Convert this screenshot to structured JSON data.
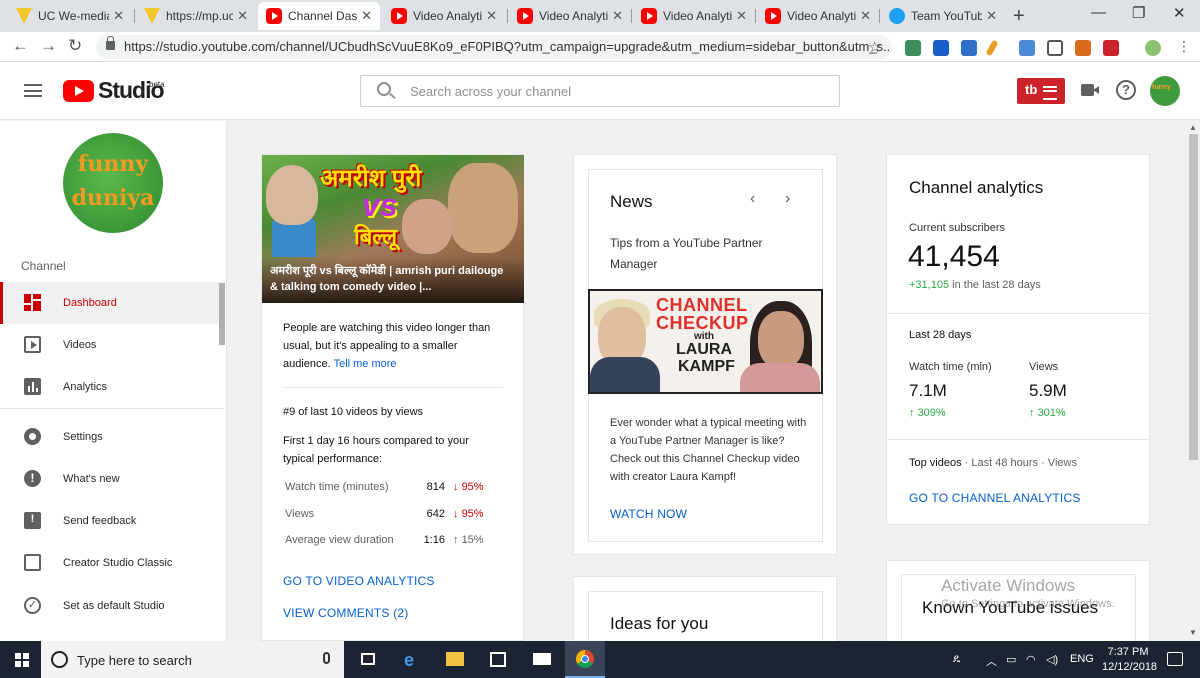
{
  "browser": {
    "tabs": [
      {
        "label": "UC We-media",
        "favicon": "uc-icon",
        "active": false
      },
      {
        "label": "https://mp.ucw",
        "favicon": "uc-icon",
        "active": false
      },
      {
        "label": "Channel Dashb",
        "favicon": "youtube-icon",
        "active": true
      },
      {
        "label": "Video Analytic",
        "favicon": "youtube-icon",
        "active": false
      },
      {
        "label": "Video Analytic",
        "favicon": "youtube-icon",
        "active": false
      },
      {
        "label": "Video Analytic",
        "favicon": "youtube-icon",
        "active": false
      },
      {
        "label": "Video Analytic",
        "favicon": "youtube-icon",
        "active": false
      },
      {
        "label": "Team YouTube",
        "favicon": "twitter-icon",
        "active": false
      }
    ],
    "url": "https://studio.youtube.com/channel/UCbudhScVuuE8Ko9_eF0PIBQ?utm_campaign=upgrade&utm_medium=sidebar_button&utm_s..."
  },
  "header": {
    "logo_text": "Studio",
    "beta_label": "beta",
    "search_placeholder": "Search across your channel",
    "tubebuddy_label": "tb"
  },
  "sidebar": {
    "avatar_text_top": "funny",
    "avatar_text_bottom": "duniya",
    "channel_label": "Channel",
    "items": [
      {
        "label": "Dashboard",
        "icon": "dashboard-icon"
      },
      {
        "label": "Videos",
        "icon": "videos-icon"
      },
      {
        "label": "Analytics",
        "icon": "analytics-icon"
      },
      {
        "label": "Settings",
        "icon": "settings-icon"
      },
      {
        "label": "What's new",
        "icon": "whats-new-icon"
      },
      {
        "label": "Send feedback",
        "icon": "feedback-icon"
      },
      {
        "label": "Creator Studio Classic",
        "icon": "classic-icon"
      },
      {
        "label": "Set as default Studio",
        "icon": "check-circle-icon"
      }
    ]
  },
  "latest_video": {
    "thumb_text_1": "अमरीश पुरी",
    "thumb_text_2": "vs",
    "thumb_text_3": "बिल्लू",
    "title": "अमरीश पूरी vs बिल्लू कॉमेडी | amrish puri dailouge & talking tom comedy video |...",
    "insight_text": "People are watching this video longer than usual, but it's appealing to a smaller audience.",
    "insight_link": "Tell me more",
    "rank_text": "#9 of last 10 videos by views",
    "comparison_text": "First 1 day 16 hours compared to your typical performance:",
    "metrics": [
      {
        "name": "Watch time (minutes)",
        "value": "814",
        "change": "95%",
        "direction": "down"
      },
      {
        "name": "Views",
        "value": "642",
        "change": "95%",
        "direction": "down"
      },
      {
        "name": "Average view duration",
        "value": "1:16",
        "change": "15%",
        "direction": "up"
      }
    ],
    "analytics_link": "GO TO VIDEO ANALYTICS",
    "comments_link": "VIEW COMMENTS (2)"
  },
  "news": {
    "title": "News",
    "subtitle": "Tips from a YouTube Partner Manager",
    "image_text_1": "CHANNEL",
    "image_text_2": "CHECKUP",
    "image_text_3": "with",
    "image_text_4": "LAURA",
    "image_text_5": "KAMPF",
    "body": "Ever wonder what a typical meeting with a YouTube Partner Manager is like? Check out this Channel Checkup video with creator Laura Kampf!",
    "cta": "WATCH NOW"
  },
  "ideas": {
    "title": "Ideas for you"
  },
  "channel_analytics": {
    "title": "Channel analytics",
    "subs_label": "Current subscribers",
    "subs_value": "41,454",
    "subs_gain": "+31,105",
    "subs_gain_period": "in the last 28 days",
    "period_label": "Last 28 days",
    "watch_label": "Watch time (min)",
    "watch_value": "7.1M",
    "watch_change": "309%",
    "views_label": "Views",
    "views_value": "5.9M",
    "views_change": "301%",
    "top_videos_label": "Top videos",
    "top_videos_meta": "· Last 48 hours · Views",
    "link": "GO TO CHANNEL ANALYTICS"
  },
  "known_issues": {
    "title": "Known YouTube issues"
  },
  "watermark": {
    "line1": "Activate Windows",
    "line2": "Go to Settings to activate Windows."
  },
  "taskbar": {
    "search_text": "Type here to search",
    "language": "ENG",
    "time": "7:37 PM",
    "date": "12/12/2018"
  },
  "colors": {
    "youtube_red": "#ff0000",
    "active_red": "#cc0000",
    "link_blue": "#065fd4",
    "up_green": "#2ba640",
    "taskbar": "#1c2434"
  }
}
